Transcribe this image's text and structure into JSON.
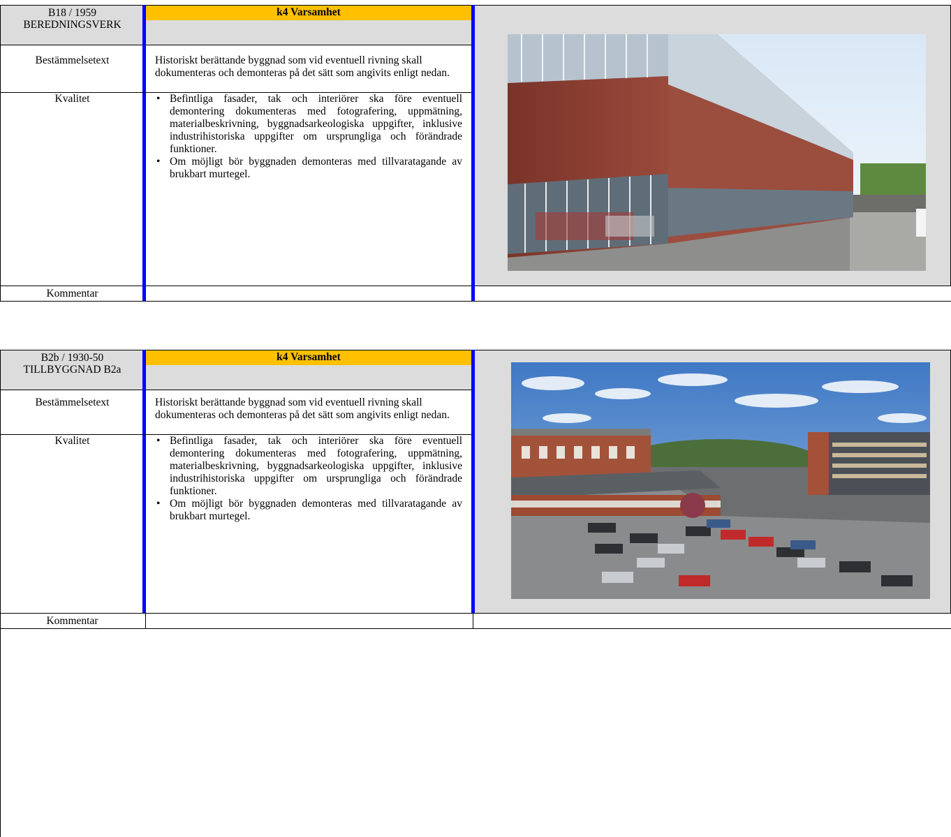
{
  "entries": [
    {
      "status": "k4 Varsamhet",
      "building_id": "B18 / 1959",
      "building_name": "BEREDNINGSVERK",
      "fields": {
        "bestammelsetext_label": "Bestämmelsetext",
        "bestammelsetext": "Historiskt berättande byggnad som vid eventuell rivning skall dokumenteras och demonteras på det sätt som angivits enligt nedan.",
        "kvalitet_label": "Kvalitet",
        "kvalitet": [
          "Befintliga fasader, tak och interiörer ska före eventuell demontering dokumenteras med fotografering, uppmätning, materialbeskrivning, byggnadsarkeologiska uppgifter, inklusive industrihistoriska uppgifter om ursprungliga och förändrade funktioner.",
          "Om möjligt bör byggnaden demonteras med tillvaratagande av brukbart murtegel."
        ],
        "kommentar_label": "Kommentar",
        "kommentar": ""
      },
      "photo_icon": "brick-building-photo"
    },
    {
      "status": "k4 Varsamhet",
      "building_id": "B2b / 1930-50",
      "building_name": "TILLBYGGNAD B2a",
      "fields": {
        "bestammelsetext_label": "Bestämmelsetext",
        "bestammelsetext": "Historiskt berättande byggnad som vid eventuell rivning skall dokumenteras och demonteras på det sätt som angivits enligt nedan.",
        "kvalitet_label": "Kvalitet",
        "kvalitet": [
          "Befintliga fasader, tak och interiörer ska före eventuell demontering dokumenteras med fotografering, uppmätning, materialbeskrivning, byggnadsarkeologiska uppgifter, inklusive industrihistoriska uppgifter om ursprungliga och förändrade funktioner.",
          "Om möjligt bör byggnaden demonteras med tillvaratagande av brukbart murtegel."
        ],
        "kommentar_label": "Kommentar",
        "kommentar": ""
      },
      "photo_icon": "parking-lot-photo"
    }
  ],
  "colors": {
    "status_bg": "#ffc000",
    "accent_blue": "#0000ff",
    "panel_gray": "#dcdcdc"
  }
}
